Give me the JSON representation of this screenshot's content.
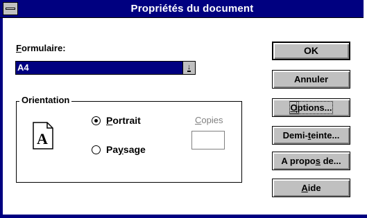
{
  "window": {
    "title": "Propriétés du document"
  },
  "form": {
    "label_prefix": "F",
    "label_rest": "ormulaire:",
    "selected": "A4",
    "dropdown_glyph": "↓"
  },
  "orientation": {
    "title": "Orientation",
    "page_letter": "A",
    "portrait": {
      "u": "P",
      "rest": "ortrait",
      "selected": true
    },
    "paysage": {
      "pre": "Pa",
      "u": "y",
      "rest": "sage",
      "selected": false
    }
  },
  "copies": {
    "u": "C",
    "rest": "opies",
    "value": ""
  },
  "buttons": {
    "ok": "OK",
    "cancel": "Annuler",
    "options": {
      "u": "O",
      "rest": "ptions..."
    },
    "demi": {
      "pre": "Demi-",
      "u": "t",
      "rest": "einte..."
    },
    "apropos": {
      "pre": "A propo",
      "u": "s",
      "rest": " de..."
    },
    "aide": {
      "u": "A",
      "rest": "ide"
    }
  }
}
